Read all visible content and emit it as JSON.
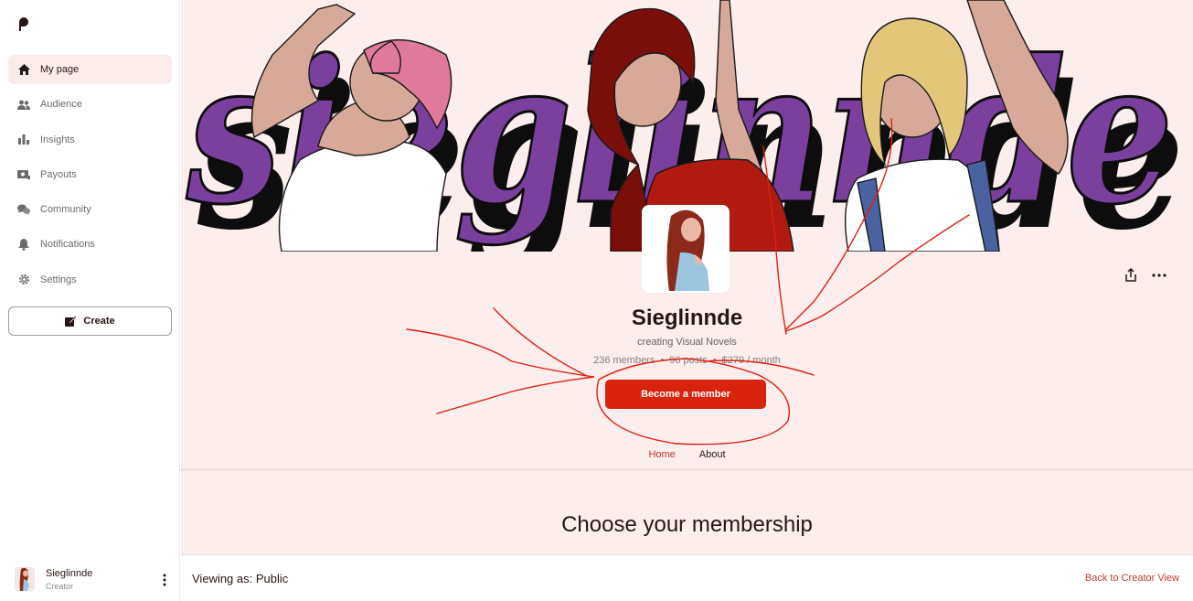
{
  "sidebar": {
    "logo_icon": "patreon-logo-icon",
    "nav": [
      {
        "label": "My page",
        "icon": "home-icon",
        "active": true
      },
      {
        "label": "Audience",
        "icon": "people-icon"
      },
      {
        "label": "Insights",
        "icon": "bar-chart-icon"
      },
      {
        "label": "Payouts",
        "icon": "payout-icon"
      },
      {
        "label": "Community",
        "icon": "chat-bubbles-icon"
      },
      {
        "label": "Notifications",
        "icon": "bell-icon"
      },
      {
        "label": "Settings",
        "icon": "gear-icon"
      }
    ],
    "create_label": "Create",
    "user": {
      "name": "Sieglinnde",
      "role": "Creator"
    }
  },
  "profile": {
    "banner_word": "sieglinnde",
    "name": "Sieglinnde",
    "tagline": "creating Visual Novels",
    "stats": {
      "members": "236 members",
      "posts": "96 posts",
      "income": "$279 / month"
    },
    "cta_label": "Become a member",
    "tabs": [
      {
        "label": "Home",
        "active": true
      },
      {
        "label": "About"
      }
    ]
  },
  "membership": {
    "heading": "Choose your membership"
  },
  "footer": {
    "viewing_label": "Viewing as: Public",
    "back_label": "Back to Creator View"
  },
  "colors": {
    "accent": "#d9230f",
    "page_bg": "#fbeeed",
    "banner_purple": "#7b3f9e",
    "annotation_red": "#e02010"
  }
}
